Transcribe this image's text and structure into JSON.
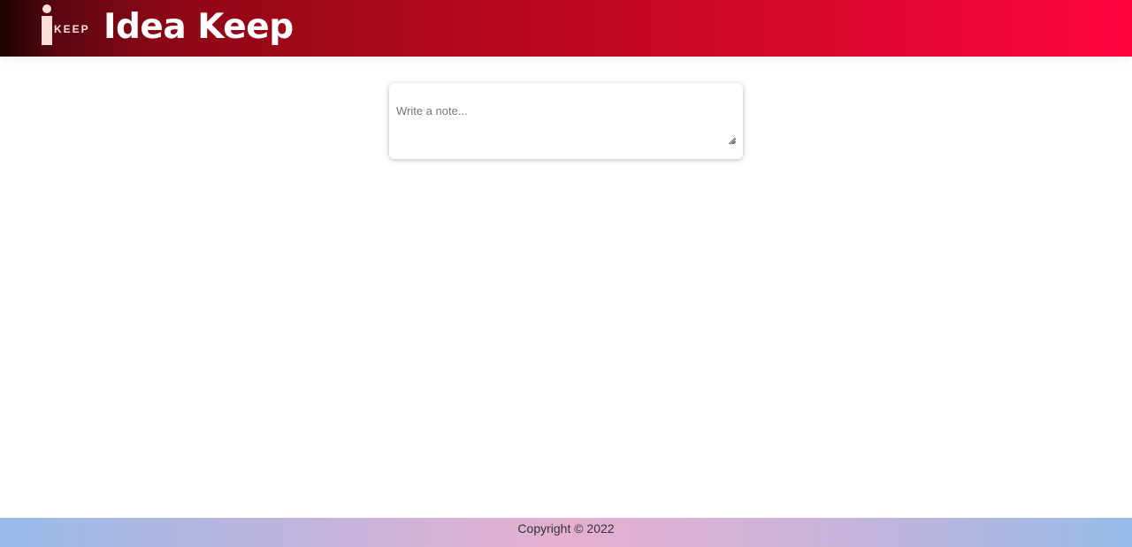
{
  "header": {
    "logo_text": "KEEP",
    "app_title": "Idea Keep",
    "brand_gradient": [
      "#1b0203",
      "#8b0715",
      "#d5082d",
      "#ff053f"
    ]
  },
  "note_editor": {
    "placeholder": "Write a note...",
    "value": ""
  },
  "footer": {
    "copyright": "Copyright © 2022",
    "gradient": [
      "#98bbe8",
      "#e6b0d0",
      "#98bbe8"
    ]
  },
  "icons": {
    "logo": "ikeep-logo-icon",
    "resize": "resize-grip-icon"
  }
}
